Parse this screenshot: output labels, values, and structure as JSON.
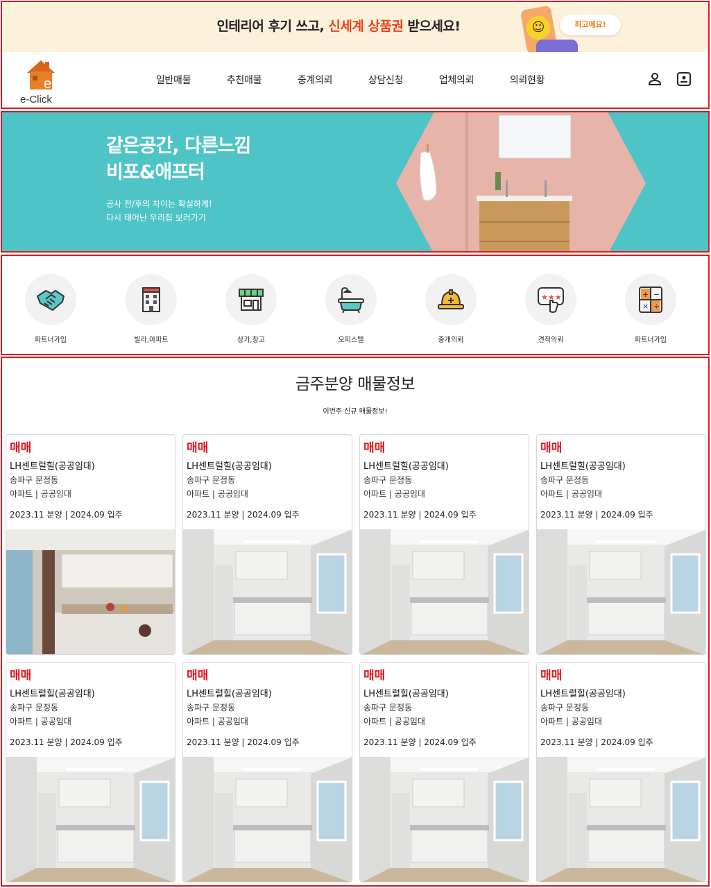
{
  "promo": {
    "text_before": "인테리어 후기 쓰고, ",
    "text_highlight": "신세계 상품권",
    "text_after": " 받으세요!",
    "bubble": "최고에요!",
    "highlight_color": "#e8431c"
  },
  "header": {
    "logo_text": "e-Click",
    "nav": [
      "일반매물",
      "추천매물",
      "중계의뢰",
      "상담신청",
      "업체의뢰",
      "의뢰현황"
    ],
    "icons": [
      "user-icon",
      "account-card-icon"
    ]
  },
  "banner": {
    "title_line1": "같은공간, 다른느낌",
    "title_line2": "비포&애프터",
    "sub_line1": "공사 전/후의 차이는 확실하게!",
    "sub_line2": "다시 태어난 우리집 보러가기",
    "bg_color": "#4fc4c6"
  },
  "categories": [
    {
      "label": "파트너가입",
      "icon": "handshake-icon"
    },
    {
      "label": "빌라,아파트",
      "icon": "building-icon"
    },
    {
      "label": "상가,창고",
      "icon": "store-icon"
    },
    {
      "label": "오피스텔",
      "icon": "bathtub-icon"
    },
    {
      "label": "중개의뢰",
      "icon": "hard-hat-icon"
    },
    {
      "label": "견적의뢰",
      "icon": "review-stars-icon"
    },
    {
      "label": "파트너가입",
      "icon": "calculator-icon"
    }
  ],
  "listings": {
    "title": "금주분양 매물정보",
    "subtitle": "이번주 신규 매물정보!",
    "items": [
      {
        "badge": "매매",
        "name": "LH센트럴힐(공공임대)",
        "location": "송파구 문정동",
        "type": "아파트 | 공공임대",
        "date": "2023.11 분양 | 2024.09 입주",
        "photo": "kitchen-occupied"
      },
      {
        "badge": "매매",
        "name": "LH센트럴힐(공공임대)",
        "location": "송파구 문정동",
        "type": "아파트 | 공공임대",
        "date": "2023.11 분양 | 2024.09 입주",
        "photo": "kitchen-empty"
      },
      {
        "badge": "매매",
        "name": "LH센트럴힐(공공임대)",
        "location": "송파구 문정동",
        "type": "아파트 | 공공임대",
        "date": "2023.11 분양 | 2024.09 입주",
        "photo": "kitchen-empty"
      },
      {
        "badge": "매매",
        "name": "LH센트럴힐(공공임대)",
        "location": "송파구 문정동",
        "type": "아파트 | 공공임대",
        "date": "2023.11 분양 | 2024.09 입주",
        "photo": "kitchen-empty"
      },
      {
        "badge": "매매",
        "name": "LH센트럴힐(공공임대)",
        "location": "송파구 문정동",
        "type": "아파트 | 공공임대",
        "date": "2023.11 분양 | 2024.09 입주",
        "photo": "kitchen-empty"
      },
      {
        "badge": "매매",
        "name": "LH센트럴힐(공공임대)",
        "location": "송파구 문정동",
        "type": "아파트 | 공공임대",
        "date": "2023.11 분양 | 2024.09 입주",
        "photo": "kitchen-empty"
      },
      {
        "badge": "매매",
        "name": "LH센트럴힐(공공임대)",
        "location": "송파구 문정동",
        "type": "아파트 | 공공임대",
        "date": "2023.11 분양 | 2024.09 입주",
        "photo": "kitchen-empty"
      },
      {
        "badge": "매매",
        "name": "LH센트럴힐(공공임대)",
        "location": "송파구 문정동",
        "type": "아파트 | 공공임대",
        "date": "2023.11 분양 | 2024.09 입주",
        "photo": "kitchen-empty"
      }
    ]
  }
}
